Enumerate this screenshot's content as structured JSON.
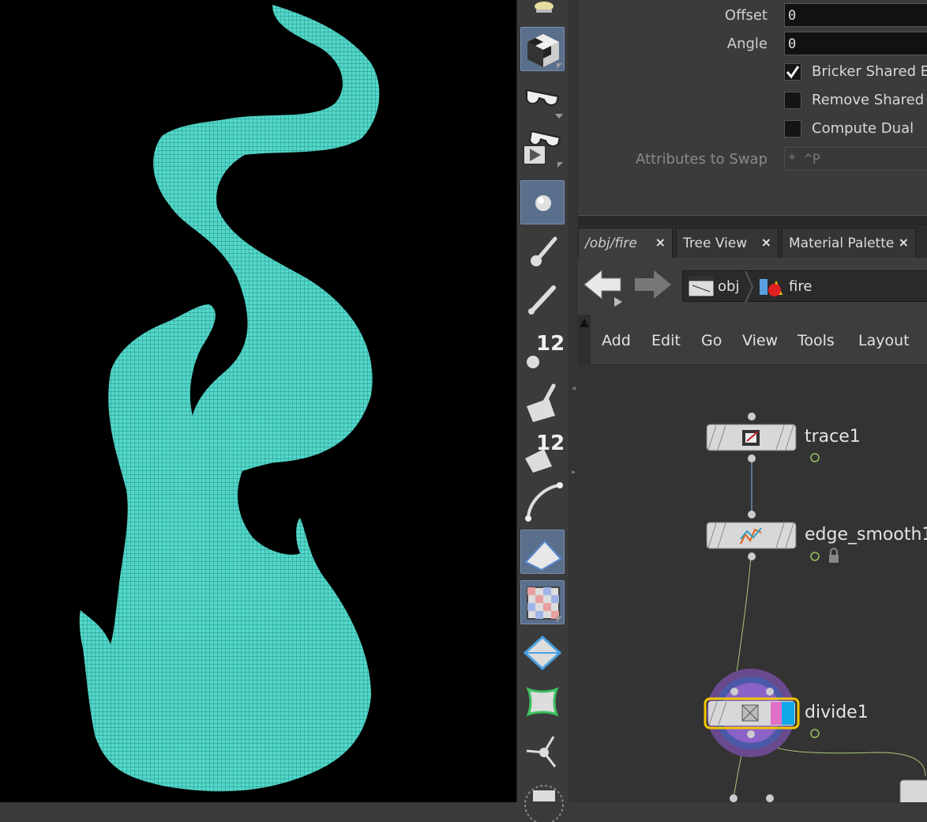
{
  "params": {
    "offset": {
      "label": "Offset",
      "value": "0"
    },
    "angle": {
      "label": "Angle",
      "value": "0"
    },
    "bricker_shared": {
      "label": "Bricker Shared Ed",
      "checked": true
    },
    "remove_shared": {
      "label": "Remove Shared E",
      "checked": false
    },
    "compute_dual": {
      "label": "Compute Dual",
      "checked": false
    },
    "attributes_to_swap": {
      "label": "Attributes to Swap",
      "value": "*  ^P"
    }
  },
  "tabs": [
    {
      "label": "/obj/fire",
      "close": "×"
    },
    {
      "label": "Tree View",
      "close": "×"
    },
    {
      "label": "Material Palette",
      "close": "×"
    }
  ],
  "path": {
    "obj": "obj",
    "fire": "fire"
  },
  "menu": [
    "Add",
    "Edit",
    "Go",
    "View",
    "Tools",
    "Layout"
  ],
  "toolbar": {
    "snap_count_1": "12",
    "snap_count_2": "12"
  },
  "nodes": {
    "trace": "trace1",
    "edge_smooth": "edge_smooth1",
    "divide": "divide1"
  },
  "colors": {
    "mesh": "#4fd6c8",
    "selected_node_outline": "#f2c500",
    "divide_ring": "#7a5aa8"
  }
}
